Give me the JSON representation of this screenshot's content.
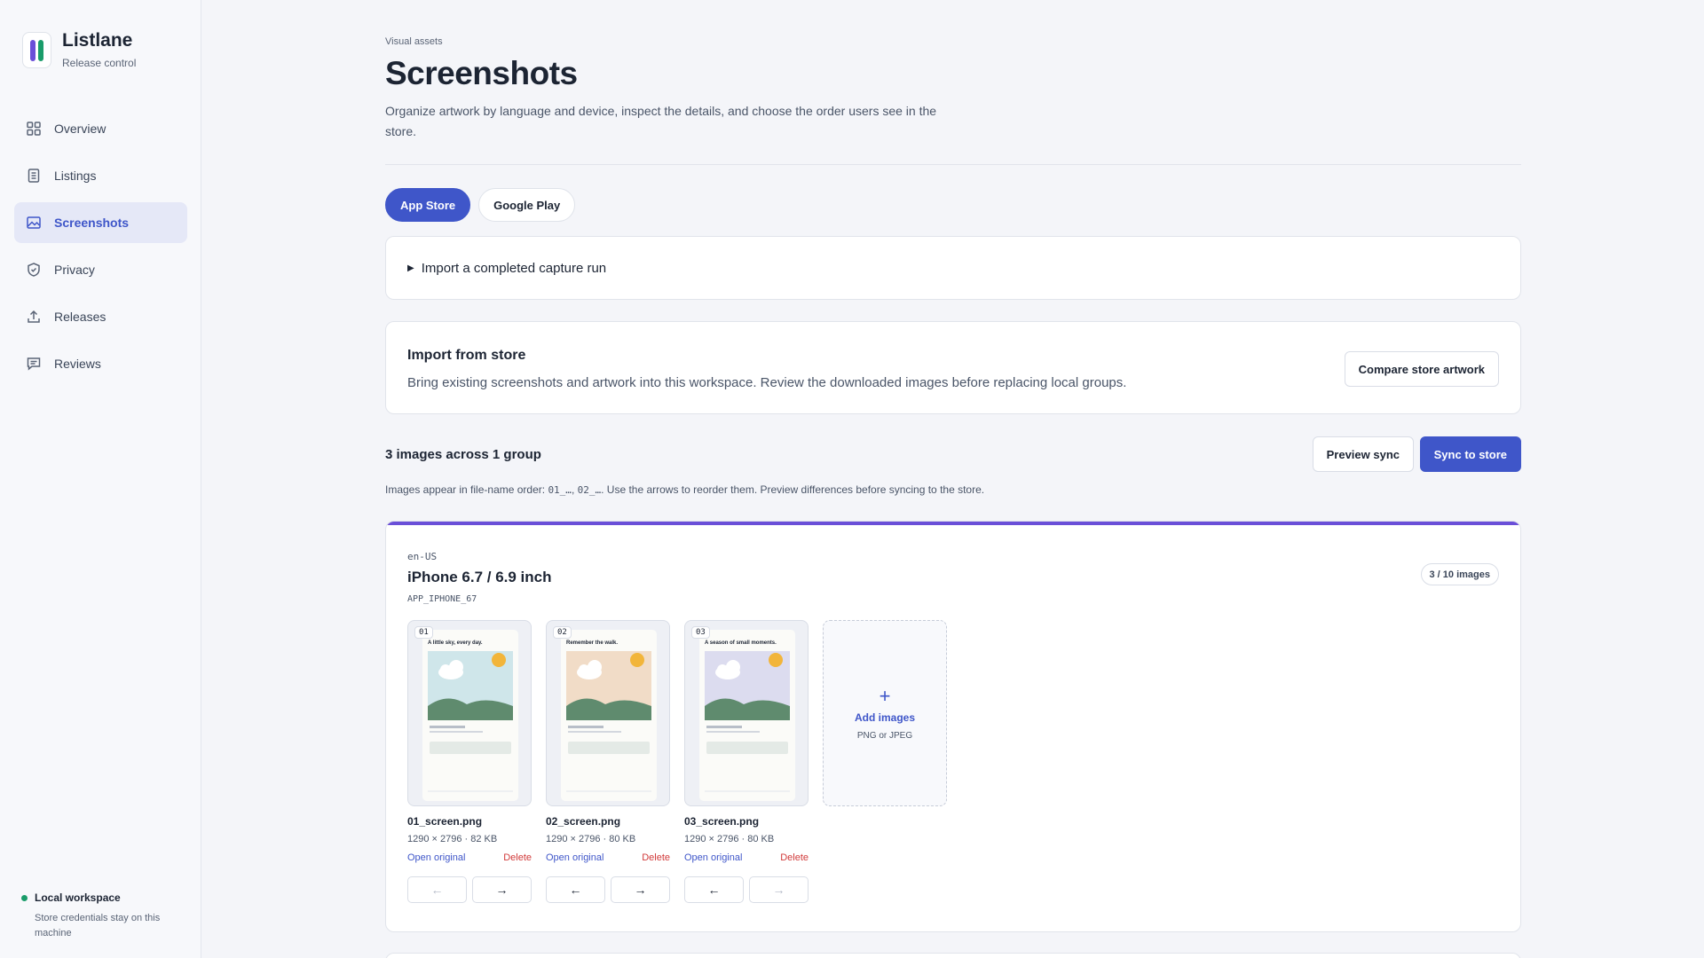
{
  "sidebar": {
    "app_name": "Listlane",
    "app_subtitle": "Release control",
    "items": [
      {
        "label": "Overview",
        "icon": "grid-icon",
        "active": false
      },
      {
        "label": "Listings",
        "icon": "document-icon",
        "active": false
      },
      {
        "label": "Screenshots",
        "icon": "image-icon",
        "active": true
      },
      {
        "label": "Privacy",
        "icon": "shield-icon",
        "active": false
      },
      {
        "label": "Releases",
        "icon": "upload-icon",
        "active": false
      },
      {
        "label": "Reviews",
        "icon": "chat-icon",
        "active": false
      }
    ],
    "workspace": {
      "title": "Local workspace",
      "subtitle": "Store credentials stay on this machine"
    }
  },
  "page": {
    "eyebrow": "Visual assets",
    "title": "Screenshots",
    "description": "Organize artwork by language and device, inspect the details, and choose the order users see in the store."
  },
  "tabs": [
    {
      "label": "App Store",
      "active": true
    },
    {
      "label": "Google Play",
      "active": false
    }
  ],
  "capture_run": {
    "label": "Import a completed capture run"
  },
  "import_store": {
    "title": "Import from store",
    "description": "Bring existing screenshots and artwork into this workspace. Review the downloaded images before replacing local groups.",
    "button": "Compare store artwork"
  },
  "summary": {
    "count_label": "3 images across 1 group",
    "preview_button": "Preview sync",
    "sync_button": "Sync to store",
    "hint_prefix": "Images appear in file-name order: ",
    "hint_code1": "01_…",
    "hint_sep": ", ",
    "hint_code2": "02_…",
    "hint_suffix": ". Use the arrows to reorder them. Preview differences before syncing to the store."
  },
  "group": {
    "locale": "en-US",
    "device": "iPhone 6.7 / 6.9 inch",
    "device_code": "APP_IPHONE_67",
    "badge": "3 / 10 images",
    "accent_color": "#6a4fd8",
    "screenshots": [
      {
        "index": "01",
        "file": "01_screen.png",
        "meta": "1290 × 2796 · 82 KB",
        "open": "Open original",
        "delete": "Delete",
        "caption": "A little sky, every day.",
        "scene_color": "#cfe6ea",
        "left_disabled": true,
        "right_disabled": false
      },
      {
        "index": "02",
        "file": "02_screen.png",
        "meta": "1290 × 2796 · 80 KB",
        "open": "Open original",
        "delete": "Delete",
        "caption": "Remember the walk.",
        "scene_color": "#f1dcc7",
        "left_disabled": false,
        "right_disabled": false
      },
      {
        "index": "03",
        "file": "03_screen.png",
        "meta": "1290 × 2796 · 80 KB",
        "open": "Open original",
        "delete": "Delete",
        "caption": "A season of small moments.",
        "scene_color": "#dcdcef",
        "left_disabled": false,
        "right_disabled": true
      }
    ],
    "add": {
      "label": "Add images",
      "sub": "PNG or JPEG"
    }
  },
  "colors": {
    "accent": "#3f56c9",
    "danger": "#d13a3a",
    "success": "#1a9c6a"
  }
}
